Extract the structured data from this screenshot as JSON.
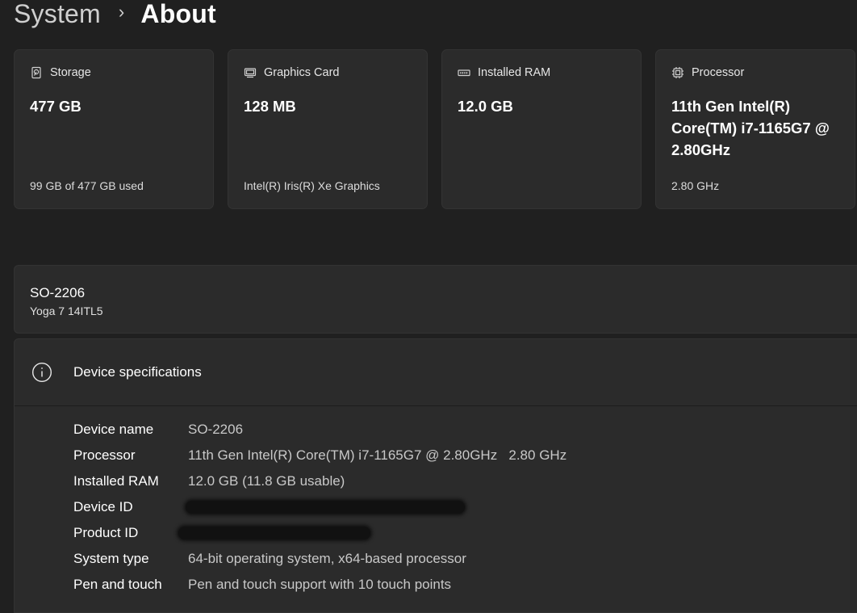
{
  "breadcrumb": {
    "parent": "System",
    "separator": "›",
    "current": "About"
  },
  "cards": [
    {
      "icon": "storage-icon",
      "title": "Storage",
      "value": "477 GB",
      "sub": "99 GB of 477 GB used"
    },
    {
      "icon": "graphics-card-icon",
      "title": "Graphics Card",
      "value": "128 MB",
      "sub": "Intel(R) Iris(R) Xe Graphics"
    },
    {
      "icon": "ram-icon",
      "title": "Installed RAM",
      "value": "12.0 GB",
      "sub": ""
    },
    {
      "icon": "processor-icon",
      "title": "Processor",
      "value": "11th Gen Intel(R) Core(TM) i7-1165G7 @ 2.80GHz",
      "sub": "2.80 GHz"
    }
  ],
  "device": {
    "name": "SO-2206",
    "model": "Yoga 7 14ITL5"
  },
  "specs": {
    "title": "Device specifications",
    "rows": [
      {
        "label": "Device name",
        "value": "SO-2206"
      },
      {
        "label": "Processor",
        "value": "11th Gen Intel(R) Core(TM) i7-1165G7 @ 2.80GHz   2.80 GHz"
      },
      {
        "label": "Installed RAM",
        "value": "12.0 GB (11.8 GB usable)"
      },
      {
        "label": "Device ID",
        "value": ""
      },
      {
        "label": "Product ID",
        "value": ""
      },
      {
        "label": "System type",
        "value": "64-bit operating system, x64-based processor"
      },
      {
        "label": "Pen and touch",
        "value": "Pen and touch support with 10 touch points"
      }
    ]
  }
}
